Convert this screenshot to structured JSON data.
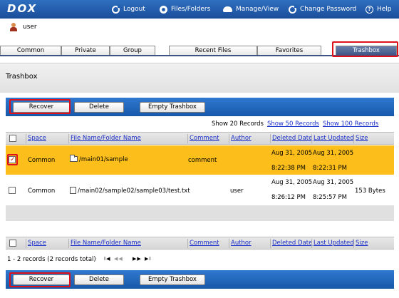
{
  "header": {
    "logo": "DOX",
    "nav": [
      {
        "label": "Logout",
        "icon": "logout-icon"
      },
      {
        "label": "Files/Folders",
        "icon": "files-folders-icon"
      },
      {
        "label": "Manage/View",
        "icon": "manage-view-icon"
      },
      {
        "label": "Change Password",
        "icon": "change-password-icon"
      },
      {
        "label": "Help",
        "icon": "help-icon"
      }
    ]
  },
  "user": {
    "name": "user"
  },
  "tabs": {
    "common": "Common",
    "private": "Private",
    "group": "Group",
    "recent": "Recent Files",
    "favorites": "Favorites",
    "trashbox": "Trashbox"
  },
  "page": {
    "title": "Trashbox"
  },
  "actions": {
    "recover": "Recover",
    "delete": "Delete",
    "empty": "Empty Trashbox"
  },
  "paging": {
    "show20": "Show 20 Records",
    "show50": "Show 50 Records",
    "show100": "Show 100 Records",
    "summary": "1 - 2 records (2 records total)",
    "pager_first": "I◀",
    "pager_prev": "◀◀",
    "pager_next": "▶▶",
    "pager_last": "▶I"
  },
  "table": {
    "columns": {
      "space": "Space",
      "name": "File Name/Folder Name",
      "comment": "Comment",
      "author": "Author",
      "deleted": "Deleted Date",
      "updated": "Last Updated",
      "size": "Size"
    },
    "rows": [
      {
        "checked": true,
        "space": "Common",
        "name": "/main01/sample",
        "comment": "comment",
        "author": "",
        "deleted_date": "Aug 31, 2005",
        "deleted_time": "8:22:38 PM",
        "updated_date": "Aug 31, 2005",
        "updated_time": "8:22:31 PM",
        "size": ""
      },
      {
        "checked": false,
        "space": "Common",
        "name": "/main02/sample02/sample03/test.txt",
        "comment": "",
        "author": "user",
        "deleted_date": "Aug 31, 2005",
        "deleted_time": "8:26:12 PM",
        "updated_date": "Aug 31, 2005",
        "updated_time": "8:25:57 PM",
        "size": "153 Bytes"
      }
    ]
  },
  "colors": {
    "highlight_row": "#fcbe1a",
    "accent_blue": "#1e63b8",
    "callout_red": "#e0101a"
  }
}
